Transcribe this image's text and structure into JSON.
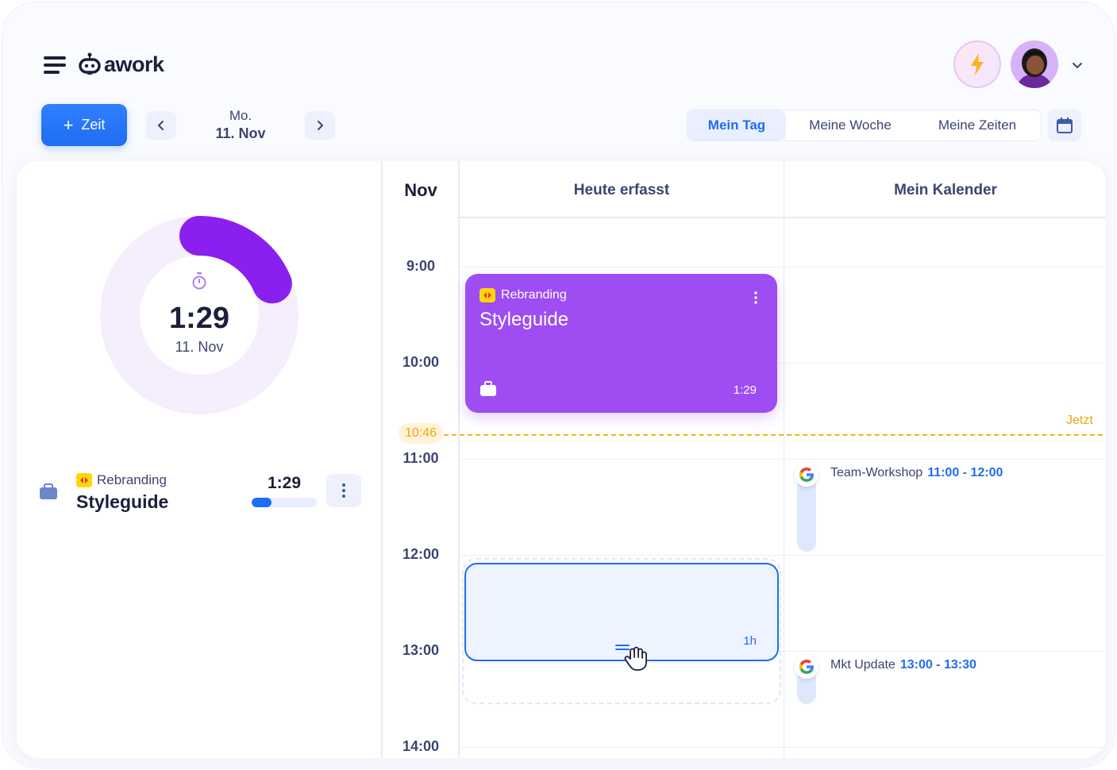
{
  "header": {
    "brand": "awork"
  },
  "toolbar": {
    "add_label": "Zeit",
    "date_weekday": "Mo.",
    "date_day": "11. Nov",
    "views": [
      "Mein Tag",
      "Meine Woche",
      "Meine Zeiten"
    ],
    "active_view": "Mein Tag"
  },
  "summary": {
    "total": "1:29",
    "date": "11. Nov",
    "progress_fraction": 0.185
  },
  "entries": [
    {
      "project": "Rebranding",
      "task": "Styleguide",
      "duration": "1:29",
      "progress_fraction": 0.3
    }
  ],
  "calendar": {
    "month": "Nov",
    "columns": [
      "Heute erfasst",
      "Mein Kalender"
    ],
    "hours": [
      "9:00",
      "10:00",
      "11:00",
      "12:00",
      "13:00",
      "14:00"
    ],
    "now_time": "10:46",
    "now_label": "Jetzt",
    "tracked_event": {
      "project": "Rebranding",
      "title": "Styleguide",
      "duration": "1:29"
    },
    "draft_event": {
      "duration": "1h"
    },
    "calendar_events": [
      {
        "title": "Team-Workshop",
        "range": "11:00 - 12:00"
      },
      {
        "title": "Mkt Update",
        "range": "13:00 - 13:30"
      }
    ]
  },
  "colors": {
    "accent": "#1f6df2",
    "tracked": "#9d4df2",
    "now": "#f5b21b"
  },
  "icons": [
    "menu-icon",
    "awork-logo-icon",
    "lightning-icon",
    "chevron-down-icon",
    "plus-icon",
    "chevron-left-icon",
    "chevron-right-icon",
    "calendar-icon",
    "stopwatch-icon",
    "briefcase-icon",
    "more-vertical-icon",
    "project-badge-icon",
    "drag-handle-icon",
    "hand-cursor-icon",
    "google-icon"
  ]
}
